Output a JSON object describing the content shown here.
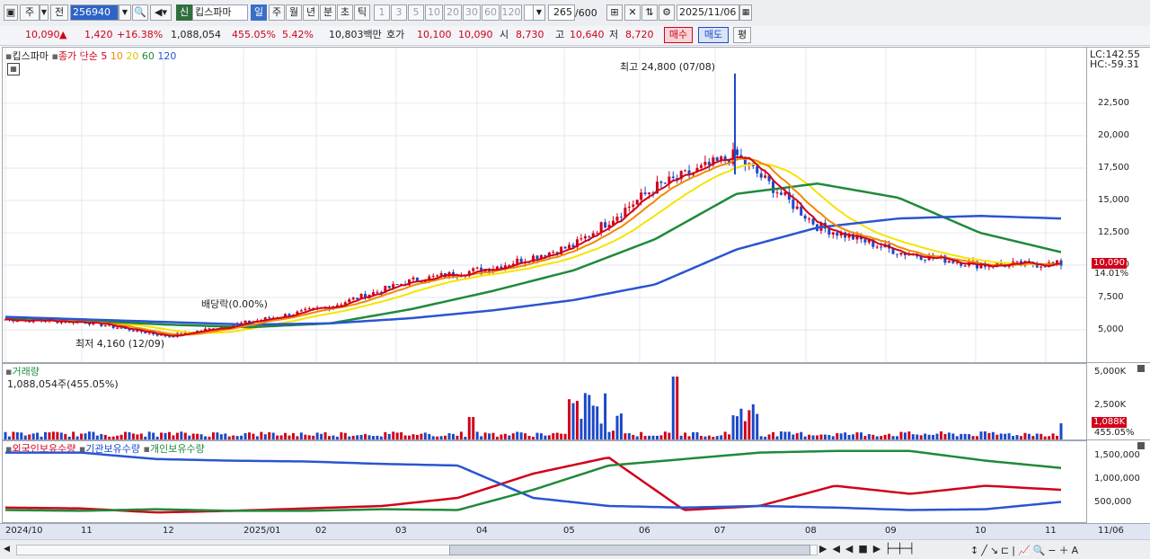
{
  "toolbar": {
    "market": "주",
    "prev": "전",
    "code": "256940",
    "badge_new": "신",
    "name": "킵스파마",
    "period_active": "일",
    "periods": [
      "주",
      "월",
      "년",
      "분",
      "초",
      "틱"
    ],
    "intervals": [
      "1",
      "3",
      "5",
      "10",
      "20",
      "30",
      "60",
      "120"
    ],
    "count": "265",
    "count_total": "/600",
    "date": "2025/11/06"
  },
  "quote": {
    "price": "10,090",
    "change": "1,420",
    "change_pct": "+16.38%",
    "volume": "1,088,054",
    "vol_ratio": "455.05%",
    "turnover_pct": "5.42%",
    "amount": "10,803백만",
    "bid_label": "호가",
    "bid1": "10,100",
    "bid2": "10,090",
    "low_label_si": "시",
    "open": "8,730",
    "high_label": "고",
    "high": "10,640",
    "low_label": "저",
    "low": "8,720",
    "buy": "매수",
    "sell": "매도",
    "avg": "평"
  },
  "price_panel": {
    "legend_name": "킵스파마",
    "legend_ma": "종가 단순",
    "ma_labels": [
      "5",
      "10",
      "20",
      "60",
      "120"
    ],
    "ma_colors": [
      "#d0021b",
      "#f08a00",
      "#e6d800",
      "#1f8a3a",
      "#2a55d0"
    ],
    "lc": "LC:142.55",
    "hc": "HC:-59.31",
    "yticks": [
      "22,500",
      "20,000",
      "17,500",
      "15,000",
      "12,500",
      "10,000",
      "7,500",
      "5,000"
    ],
    "ytick_values": [
      22500,
      20000,
      17500,
      15000,
      12500,
      10000,
      7500,
      5000
    ],
    "current_tag": "10,090",
    "current_pct": "14.01%",
    "annot_high": "최고 24,800 (07/08)",
    "annot_low": "최저 4,160 (12/09)",
    "annot_div": "배당락(0.00%)"
  },
  "volume_panel": {
    "legend": "거래량",
    "value_text": "1,088,054주(455.05%)",
    "yticks": [
      "5,000K",
      "2,500K"
    ],
    "tag": "1,088K",
    "tag_pct": "455.05%"
  },
  "holding_panel": {
    "legend": [
      "외국인보유수량",
      "기관보유수량",
      "개인보유수량"
    ],
    "colors": [
      "#d0021b",
      "#2a55d0",
      "#1f8a3a"
    ],
    "yticks": [
      "1,500,000",
      "1,000,000",
      "500,000"
    ]
  },
  "xaxis": [
    "2024/10",
    "11",
    "12",
    "2025/01",
    "02",
    "03",
    "04",
    "05",
    "06",
    "07",
    "08",
    "09",
    "10",
    "11",
    "11/06"
  ],
  "chart_data": {
    "type": "line",
    "title": "",
    "x": [
      "2024/10",
      "11",
      "12",
      "2025/01",
      "02",
      "03",
      "04",
      "05",
      "06",
      "07",
      "08",
      "09",
      "10",
      "11"
    ],
    "series": [
      {
        "name": "종가",
        "values": [
          5800,
          5600,
          4500,
          5600,
          6800,
          8800,
          9800,
          11500,
          16000,
          18500,
          13000,
          11000,
          10000,
          10090
        ]
      },
      {
        "name": "60",
        "values": [
          5900,
          5700,
          5400,
          5200,
          5500,
          6600,
          8000,
          9600,
          12000,
          15500,
          16300,
          15200,
          12500,
          11000
        ]
      },
      {
        "name": "120",
        "values": [
          6000,
          5800,
          5600,
          5400,
          5500,
          5900,
          6500,
          7300,
          8500,
          11200,
          12900,
          13600,
          13800,
          13600
        ]
      }
    ],
    "ylim": [
      4000,
      25000
    ],
    "high": {
      "value": 24800,
      "date": "07/08"
    },
    "low": {
      "value": 4160,
      "date": "12/09"
    }
  }
}
